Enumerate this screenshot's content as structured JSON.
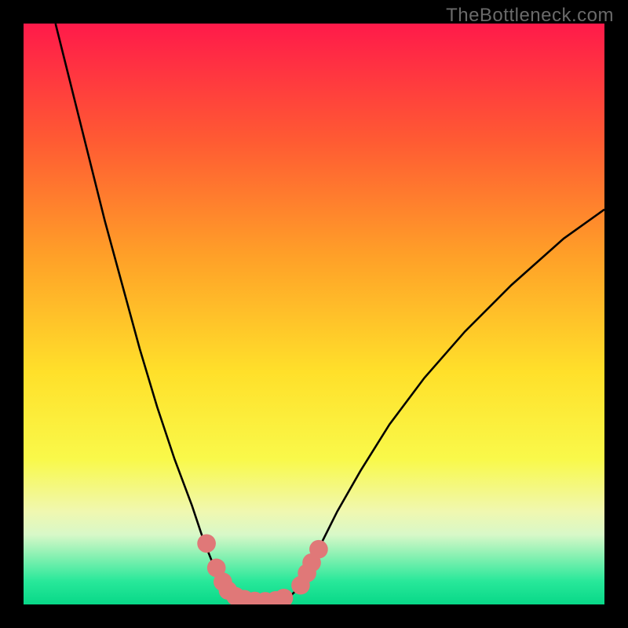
{
  "watermark": "TheBottleneck.com",
  "chart_data": {
    "type": "line",
    "title": "",
    "xlabel": "",
    "ylabel": "",
    "xlim": [
      0,
      100
    ],
    "ylim": [
      0,
      100
    ],
    "gradient_stops": [
      {
        "offset": 0,
        "color": "#ff1a4a"
      },
      {
        "offset": 20,
        "color": "#ff5a33"
      },
      {
        "offset": 40,
        "color": "#ffa028"
      },
      {
        "offset": 60,
        "color": "#ffe02a"
      },
      {
        "offset": 75,
        "color": "#f9f94a"
      },
      {
        "offset": 84,
        "color": "#f0f8b0"
      },
      {
        "offset": 88,
        "color": "#d8f8c8"
      },
      {
        "offset": 92,
        "color": "#80f0b0"
      },
      {
        "offset": 96,
        "color": "#28e89a"
      },
      {
        "offset": 100,
        "color": "#08d888"
      }
    ],
    "series": [
      {
        "name": "left-curve",
        "points": [
          {
            "x": 5.5,
            "y": 100
          },
          {
            "x": 8,
            "y": 90
          },
          {
            "x": 11,
            "y": 78
          },
          {
            "x": 14,
            "y": 66
          },
          {
            "x": 17,
            "y": 55
          },
          {
            "x": 20,
            "y": 44
          },
          {
            "x": 23,
            "y": 34
          },
          {
            "x": 26,
            "y": 25
          },
          {
            "x": 29,
            "y": 17
          },
          {
            "x": 31,
            "y": 11
          },
          {
            "x": 33,
            "y": 6
          },
          {
            "x": 34.5,
            "y": 3
          },
          {
            "x": 36,
            "y": 1.5
          },
          {
            "x": 38,
            "y": 0.8
          },
          {
            "x": 41,
            "y": 0.5
          },
          {
            "x": 44,
            "y": 0.8
          },
          {
            "x": 46,
            "y": 1.5
          },
          {
            "x": 47.5,
            "y": 3
          },
          {
            "x": 49,
            "y": 6
          },
          {
            "x": 51,
            "y": 10
          },
          {
            "x": 54,
            "y": 16
          },
          {
            "x": 58,
            "y": 23
          },
          {
            "x": 63,
            "y": 31
          },
          {
            "x": 69,
            "y": 39
          },
          {
            "x": 76,
            "y": 47
          },
          {
            "x": 84,
            "y": 55
          },
          {
            "x": 93,
            "y": 63
          },
          {
            "x": 100,
            "y": 68
          }
        ]
      }
    ],
    "markers": [
      {
        "x": 31.5,
        "y": 10.5,
        "r": 1.6
      },
      {
        "x": 33.2,
        "y": 6.3,
        "r": 1.6
      },
      {
        "x": 34.3,
        "y": 3.9,
        "r": 1.6
      },
      {
        "x": 35.2,
        "y": 2.4,
        "r": 1.6
      },
      {
        "x": 36.5,
        "y": 1.4,
        "r": 1.6
      },
      {
        "x": 38.0,
        "y": 0.9,
        "r": 1.6
      },
      {
        "x": 39.8,
        "y": 0.6,
        "r": 1.6
      },
      {
        "x": 41.6,
        "y": 0.55,
        "r": 1.6
      },
      {
        "x": 43.4,
        "y": 0.7,
        "r": 1.6
      },
      {
        "x": 44.8,
        "y": 1.1,
        "r": 1.6
      },
      {
        "x": 47.7,
        "y": 3.3,
        "r": 1.6
      },
      {
        "x": 48.8,
        "y": 5.4,
        "r": 1.6
      },
      {
        "x": 49.6,
        "y": 7.2,
        "r": 1.6
      },
      {
        "x": 50.8,
        "y": 9.5,
        "r": 1.6
      }
    ],
    "marker_color": "#e07878"
  }
}
